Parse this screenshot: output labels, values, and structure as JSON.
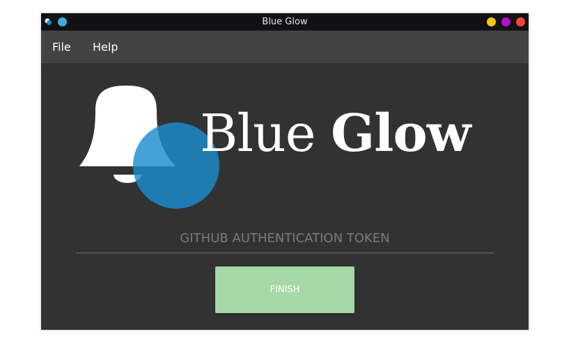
{
  "window": {
    "title": "Blue Glow",
    "controls": {
      "minimize_color": "#f5c518",
      "maximize_color": "#b40ec6",
      "close_color": "#f0453c"
    }
  },
  "menu": {
    "items": [
      {
        "label": "File"
      },
      {
        "label": "Help"
      }
    ]
  },
  "brand": {
    "name_part1": "Blue ",
    "name_part2": "Glow",
    "logo_icon": "bell-icon",
    "accent_color": "#1a8ccd"
  },
  "token": {
    "placeholder": "GITHUB AUTHENTICATION TOKEN",
    "value": ""
  },
  "actions": {
    "finish_label": "FINISH",
    "finish_color": "#a5d7a7"
  }
}
